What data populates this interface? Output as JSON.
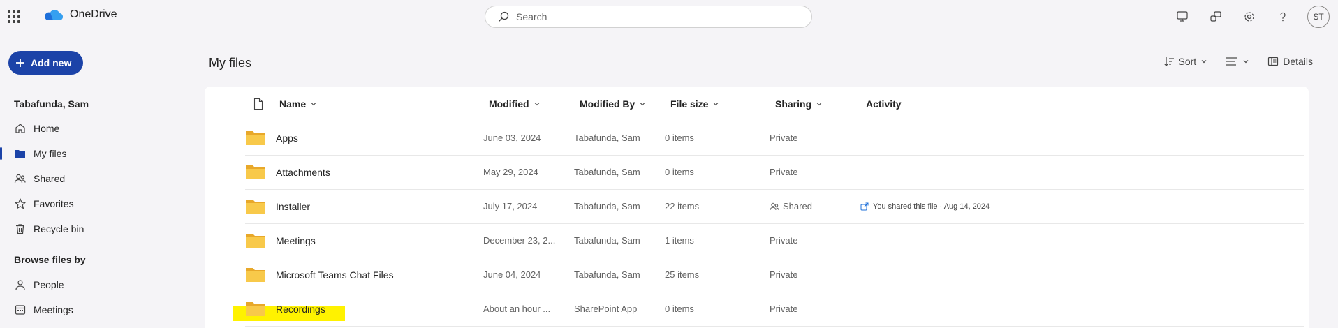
{
  "app": {
    "name": "OneDrive"
  },
  "search": {
    "placeholder": "Search"
  },
  "user": {
    "initials": "ST",
    "name": "Tabafunda, Sam"
  },
  "add_new": {
    "label": "Add new"
  },
  "nav": {
    "items": [
      {
        "label": "Home",
        "icon": "home-icon"
      },
      {
        "label": "My files",
        "icon": "folder-icon",
        "active": true
      },
      {
        "label": "Shared",
        "icon": "people-icon"
      },
      {
        "label": "Favorites",
        "icon": "star-icon"
      },
      {
        "label": "Recycle bin",
        "icon": "trash-icon"
      }
    ],
    "section_title": "Browse files by",
    "browse": [
      {
        "label": "People",
        "icon": "person-icon"
      },
      {
        "label": "Meetings",
        "icon": "calendar-icon"
      }
    ]
  },
  "main": {
    "title": "My files",
    "toolbar": {
      "sort_label": "Sort",
      "details_label": "Details"
    },
    "columns": [
      "Name",
      "Modified",
      "Modified By",
      "File size",
      "Sharing",
      "Activity"
    ],
    "rows": [
      {
        "name": "Apps",
        "modified": "June 03, 2024",
        "modified_by": "Tabafunda, Sam",
        "size": "0 items",
        "sharing": "Private",
        "activity": ""
      },
      {
        "name": "Attachments",
        "modified": "May 29, 2024",
        "modified_by": "Tabafunda, Sam",
        "size": "0 items",
        "sharing": "Private",
        "activity": ""
      },
      {
        "name": "Installer",
        "modified": "July 17, 2024",
        "modified_by": "Tabafunda, Sam",
        "size": "22 items",
        "sharing": "Shared",
        "activity": "You shared this file · Aug 14, 2024"
      },
      {
        "name": "Meetings",
        "modified": "December 23, 2...",
        "modified_by": "Tabafunda, Sam",
        "size": "1 items",
        "sharing": "Private",
        "activity": ""
      },
      {
        "name": "Microsoft Teams Chat Files",
        "modified": "June 04, 2024",
        "modified_by": "Tabafunda, Sam",
        "size": "25 items",
        "sharing": "Private",
        "activity": ""
      },
      {
        "name": "Recordings",
        "modified": "About an hour ...",
        "modified_by": "SharePoint App",
        "size": "0 items",
        "sharing": "Private",
        "activity": ""
      }
    ]
  },
  "colors": {
    "accent": "#1c43a8",
    "folder": "#f8c94a",
    "highlight": "#fff200"
  }
}
